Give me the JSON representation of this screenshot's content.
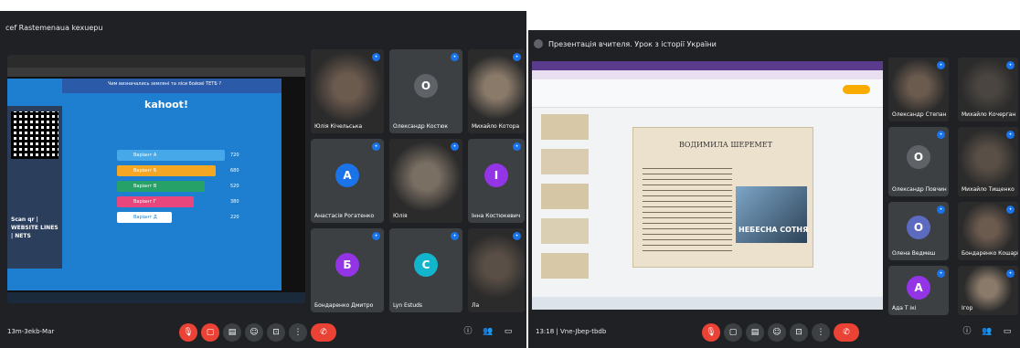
{
  "left": {
    "title": "cef Rastemenaua kexuepu",
    "time": "13m-3ekb-Mar",
    "quiz": {
      "header": "Чим визначались земляні та ліси бойові ТЕТБ ?",
      "brand": "kahoot!",
      "qr_caption": "Scan qr | WEBSITE LINES | NETS",
      "answers": [
        "Варіант А",
        "Варіант Б",
        "Варіант В",
        "Варіант Г",
        "Варіант Д"
      ],
      "scores": [
        "720",
        "680",
        "520",
        "380",
        "220"
      ],
      "answer_colors": [
        "#46a8e8",
        "#f5a623",
        "#26a269",
        "#e8467c",
        "#ffffff"
      ]
    },
    "tiles": [
      {
        "name": "Юлія Кічельська",
        "type": "video"
      },
      {
        "name": "Олександр Костюк",
        "type": "avatar",
        "letter": "О",
        "color": "#5f6368"
      },
      {
        "name": "Михайло Котора",
        "type": "video"
      },
      {
        "name": "Анастасія Рогатенко",
        "type": "avatar",
        "letter": "А",
        "color": "#1a73e8"
      },
      {
        "name": "Юлія",
        "type": "video"
      },
      {
        "name": "Інна Костюкевич",
        "type": "avatar",
        "letter": "І",
        "color": "#9334e6"
      },
      {
        "name": "Бондаренко Дмитро",
        "type": "avatar",
        "letter": "Б",
        "color": "#9334e6"
      },
      {
        "name": "Lyn Estuds",
        "type": "avatar",
        "letter": "C",
        "color": "#12b5cb"
      },
      {
        "name": "Ла",
        "type": "video"
      }
    ]
  },
  "right": {
    "title": "Презентація вчителя. Урок з історії України",
    "time": "13:18 | Vne-Jbep-tbdb",
    "slide": {
      "title": "ВОДИМИЛА ШЕРЕМЕТ",
      "image_caption": "НЕБЕСНА СОТНЯ"
    },
    "tiles": [
      {
        "name": "Олександр Степан",
        "type": "video"
      },
      {
        "name": "Михайло Кочерган",
        "type": "video"
      },
      {
        "name": "Олександр Повчин",
        "type": "avatar",
        "letter": "О",
        "color": "#5f6368"
      },
      {
        "name": "Михайло Тищенко",
        "type": "video"
      },
      {
        "name": "Олена Ведмеш",
        "type": "avatar",
        "letter": "О",
        "color": "#5c6bc0"
      },
      {
        "name": "Бондаренко Кошарів",
        "type": "video"
      },
      {
        "name": "Ада Т ікі",
        "type": "avatar",
        "letter": "А",
        "color": "#9334e6"
      },
      {
        "name": "Ігор",
        "type": "video"
      }
    ]
  },
  "colors": {
    "meet_bg": "#202124",
    "tile_bg": "#3c4043",
    "end_call": "#ea4335"
  }
}
